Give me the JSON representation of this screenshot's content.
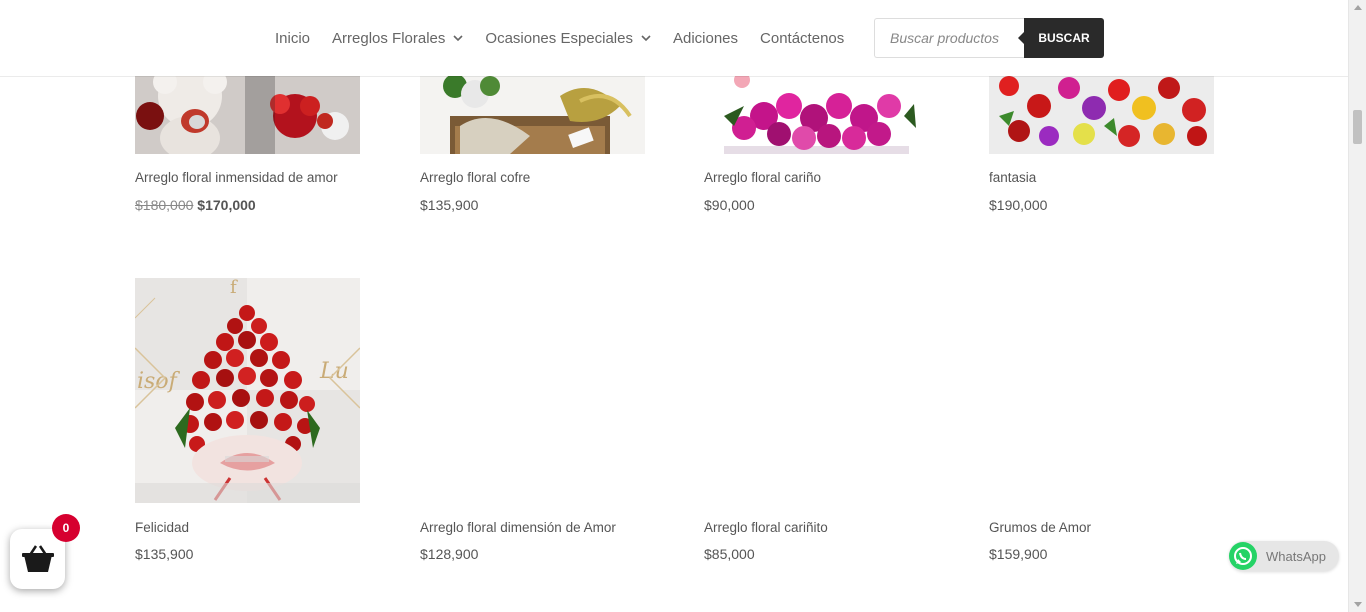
{
  "nav": {
    "items": [
      {
        "label": "Inicio",
        "dropdown": false
      },
      {
        "label": "Arreglos Florales",
        "dropdown": true
      },
      {
        "label": "Ocasiones Especiales",
        "dropdown": true
      },
      {
        "label": "Adiciones",
        "dropdown": false
      },
      {
        "label": "Contáctenos",
        "dropdown": false
      }
    ]
  },
  "search": {
    "placeholder": "Buscar productos",
    "button_label": "BUSCAR"
  },
  "products": [
    {
      "title": "Arreglo floral inmensidad de amor",
      "old_price": "$180,000",
      "price": "$170,000"
    },
    {
      "title": "Arreglo floral cofre",
      "price": "$135,900"
    },
    {
      "title": "Arreglo floral cariño",
      "price": "$90,000"
    },
    {
      "title": "fantasia",
      "price": "$190,000"
    },
    {
      "title": "Felicidad",
      "price": "$135,900"
    },
    {
      "title": "Arreglo floral dimensión de Amor",
      "price": "$128,900"
    },
    {
      "title": "Arreglo floral cariñito",
      "price": "$85,000"
    },
    {
      "title": "Grumos de Amor",
      "price": "$159,900"
    }
  ],
  "cart": {
    "count": "0"
  },
  "whatsapp": {
    "label": "WhatsApp"
  },
  "colors": {
    "cart_badge": "#d6002f",
    "button": "#2a2a2a",
    "whatsapp_green": "#25d366"
  }
}
